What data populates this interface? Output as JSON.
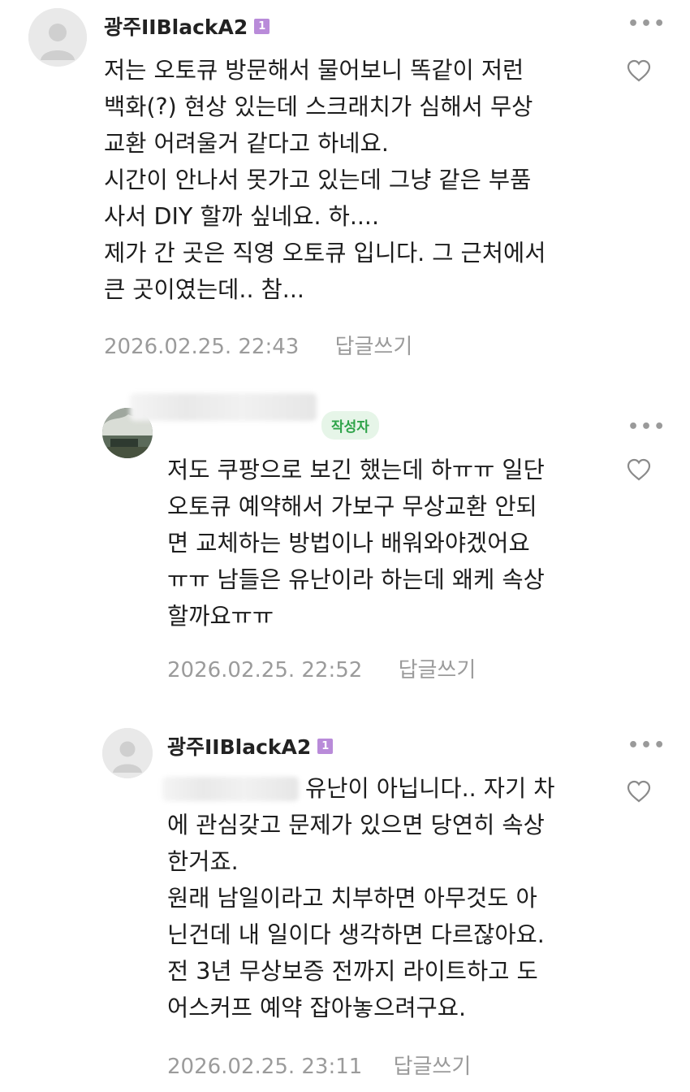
{
  "comments": [
    {
      "author": "광주IIBlackA2",
      "level_badge": "1",
      "lines": [
        "저는 오토큐 방문해서 물어보니 똑같이 저런",
        "백화(?) 현상 있는데 스크래치가 심해서 무상",
        "교환 어려울거 같다고 하네요.",
        "시간이 안나서 못가고 있는데 그냥 같은 부품",
        "사서 DIY 할까 싶네요. 하....",
        "제가 간 곳은 직영 오토큐 입니다. 그 근처에서",
        "큰 곳이였는데.. 참..."
      ],
      "timestamp": "2026.02.25. 22:43",
      "reply_label": "답글쓰기"
    },
    {
      "author_badge": "작성자",
      "lines": [
        "저도 쿠팡으로 보긴 했는데 하ㅠㅠ 일단",
        "오토큐 예약해서 가보구 무상교환 안되",
        "면 교체하는 방법이나 배워와야겠어요",
        "ㅠㅠ 남들은 유난이라 하는데 왜케 속상",
        "할까요ㅠㅠ"
      ],
      "timestamp": "2026.02.25. 22:52",
      "reply_label": "답글쓰기"
    },
    {
      "author": "광주IIBlackA2",
      "level_badge": "1",
      "first_line_text": "유난이 아닙니다.. 자기 차",
      "lines": [
        "에 관심갖고 문제가 있으면 당연히 속상",
        "한거죠.",
        "원래 남일이라고 치부하면 아무것도 아",
        "닌건데 내 일이다 생각하면 다르잖아요.",
        "전 3년 무상보증 전까지 라이트하고 도",
        "어스커프 예약 잡아놓으려구요."
      ],
      "timestamp": "2026.02.25. 23:11",
      "reply_label": "답글쓰기"
    }
  ],
  "icons": {
    "more": "more-icon",
    "like": "heart-icon",
    "avatar": "default-avatar-icon"
  },
  "colors": {
    "level_badge": "#b98bd9",
    "author_badge_bg": "#e6f5e8",
    "author_badge_text": "#2ea349",
    "meta_text": "#9b9b9b"
  }
}
